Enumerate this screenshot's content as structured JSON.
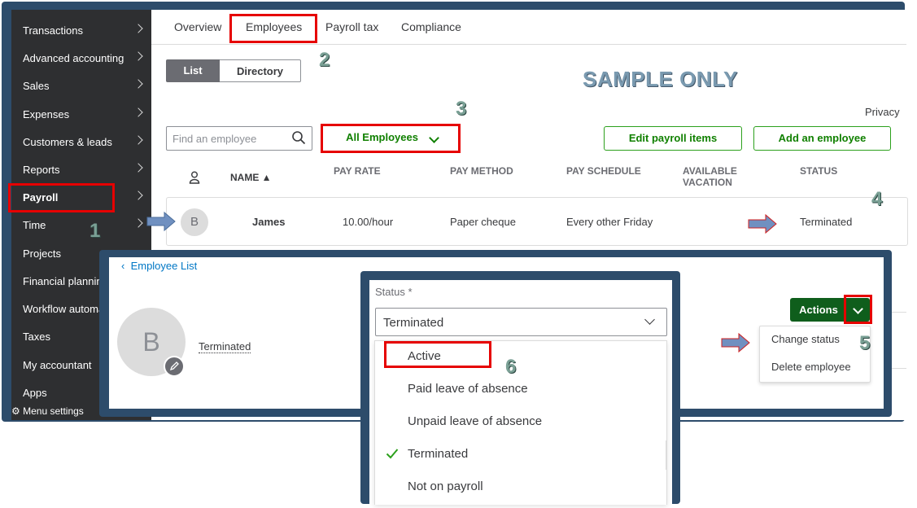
{
  "sidebar": {
    "items": [
      {
        "label": "Transactions"
      },
      {
        "label": "Advanced accounting"
      },
      {
        "label": "Sales"
      },
      {
        "label": "Expenses"
      },
      {
        "label": "Customers & leads"
      },
      {
        "label": "Reports"
      },
      {
        "label": "Payroll"
      },
      {
        "label": "Time"
      },
      {
        "label": "Projects"
      },
      {
        "label": "Financial planning"
      },
      {
        "label": "Workflow automation"
      },
      {
        "label": "Taxes"
      },
      {
        "label": "My accountant"
      },
      {
        "label": "Apps"
      }
    ],
    "menu_settings": "Menu settings"
  },
  "tabs": [
    "Overview",
    "Employees",
    "Payroll tax",
    "Compliance"
  ],
  "view_toggle": {
    "list": "List",
    "directory": "Directory"
  },
  "watermark": "SAMPLE ONLY",
  "privacy": "Privacy",
  "search": {
    "placeholder": "Find an employee"
  },
  "filter_button": "All Employees",
  "buttons": {
    "edit_payroll_items": "Edit payroll items",
    "add_employee": "Add an employee"
  },
  "table": {
    "headers": {
      "name": "NAME ▲",
      "pay_rate": "PAY RATE",
      "pay_method": "PAY METHOD",
      "pay_schedule": "PAY SCHEDULE",
      "available_vacation_1": "AVAILABLE",
      "available_vacation_2": "VACATION",
      "status": "STATUS"
    },
    "rows": [
      {
        "initial": "B",
        "name": "James",
        "pay_rate": "10.00/hour",
        "pay_method": "Paper cheque",
        "pay_schedule": "Every other Friday",
        "status": "Terminated"
      }
    ]
  },
  "steps": [
    "1",
    "2",
    "3",
    "4",
    "5",
    "6"
  ],
  "detail": {
    "back_link": "Employee List",
    "avatar_initial": "B",
    "status": "Terminated",
    "actions_label": "Actions",
    "actions_menu": [
      "Change status",
      "Delete employee"
    ]
  },
  "status_dropdown": {
    "label": "Status *",
    "selected": "Terminated",
    "options": [
      "Active",
      "Paid leave of absence",
      "Unpaid leave of absence",
      "Terminated",
      "Not on payroll"
    ]
  },
  "colors": {
    "green": "#2ca01c",
    "dark_green": "#0f5e1c",
    "sidebar": "#2e2f31",
    "frame": "#2d4c6b",
    "annotation_red": "#e60000"
  }
}
